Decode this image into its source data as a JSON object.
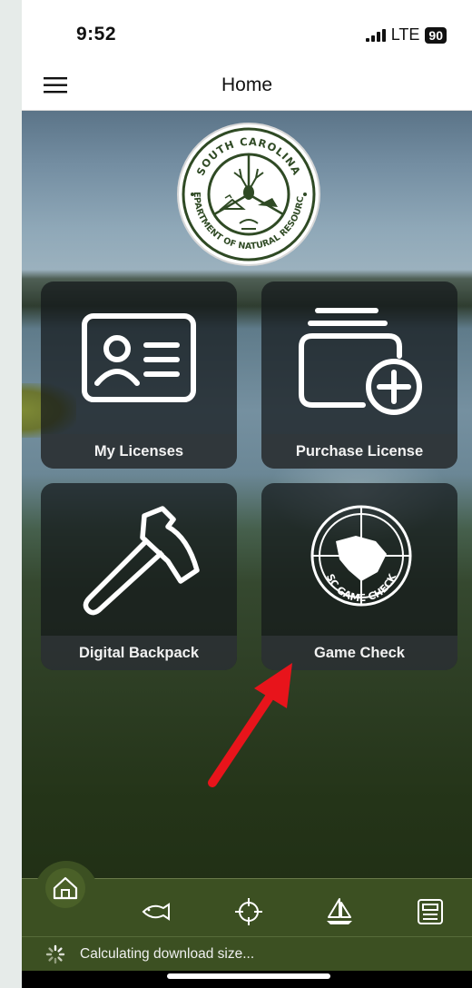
{
  "status_bar": {
    "time": "9:52",
    "network": "LTE",
    "battery": "90"
  },
  "nav": {
    "title": "Home",
    "menu_icon": "hamburger-menu-icon"
  },
  "logo": {
    "text_top": "SOUTH CAROLINA",
    "text_bottom": "DEPARTMENT OF NATURAL RESOURCES"
  },
  "tiles": [
    {
      "label": "My Licenses",
      "icon": "id-card-icon"
    },
    {
      "label": "Purchase License",
      "icon": "folder-add-icon"
    },
    {
      "label": "Digital Backpack",
      "icon": "hatchet-icon"
    },
    {
      "label": "Game Check",
      "icon": "sc-game-check-icon",
      "icon_text": "SC GAME CHECK"
    }
  ],
  "tab_bar": {
    "items": [
      {
        "name": "home",
        "icon": "home-icon",
        "active": true
      },
      {
        "name": "fish",
        "icon": "fish-icon"
      },
      {
        "name": "target",
        "icon": "crosshair-icon"
      },
      {
        "name": "boat",
        "icon": "sailboat-icon"
      },
      {
        "name": "news",
        "icon": "newspaper-icon"
      }
    ]
  },
  "download": {
    "text": "Calculating download size..."
  },
  "colors": {
    "tab_bar": "#3c5022",
    "tile_bg": "#14181a",
    "logo_green": "#2f4a24",
    "arrow": "#e8141b"
  }
}
